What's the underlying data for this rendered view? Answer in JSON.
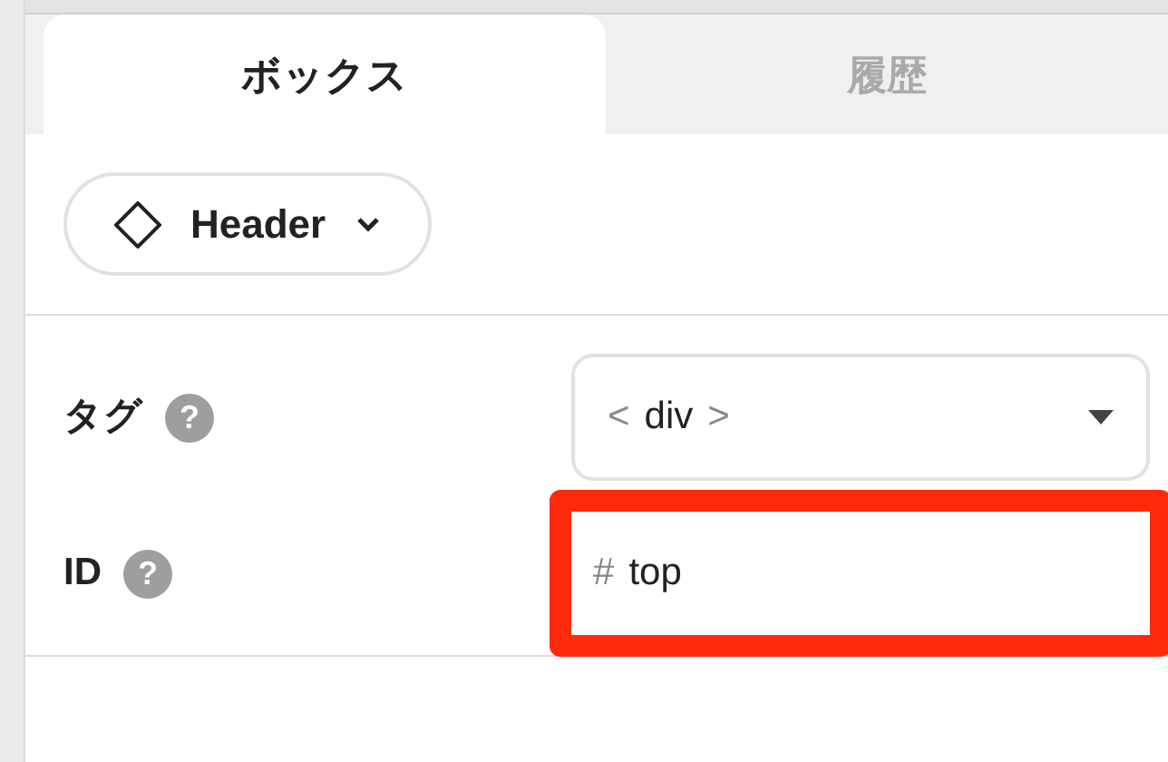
{
  "tabs": [
    {
      "label": "ボックス",
      "selected": true
    },
    {
      "label": "履歴",
      "selected": false
    }
  ],
  "element_button": {
    "label": "Header"
  },
  "fields": [
    {
      "kind": "select",
      "label": "タグ",
      "help": "?",
      "prefix": "<",
      "value": "div",
      "suffix": ">",
      "highlighted": false
    },
    {
      "kind": "text",
      "label": "ID",
      "help": "?",
      "prefix": "#",
      "value": "top",
      "highlighted": true
    }
  ]
}
